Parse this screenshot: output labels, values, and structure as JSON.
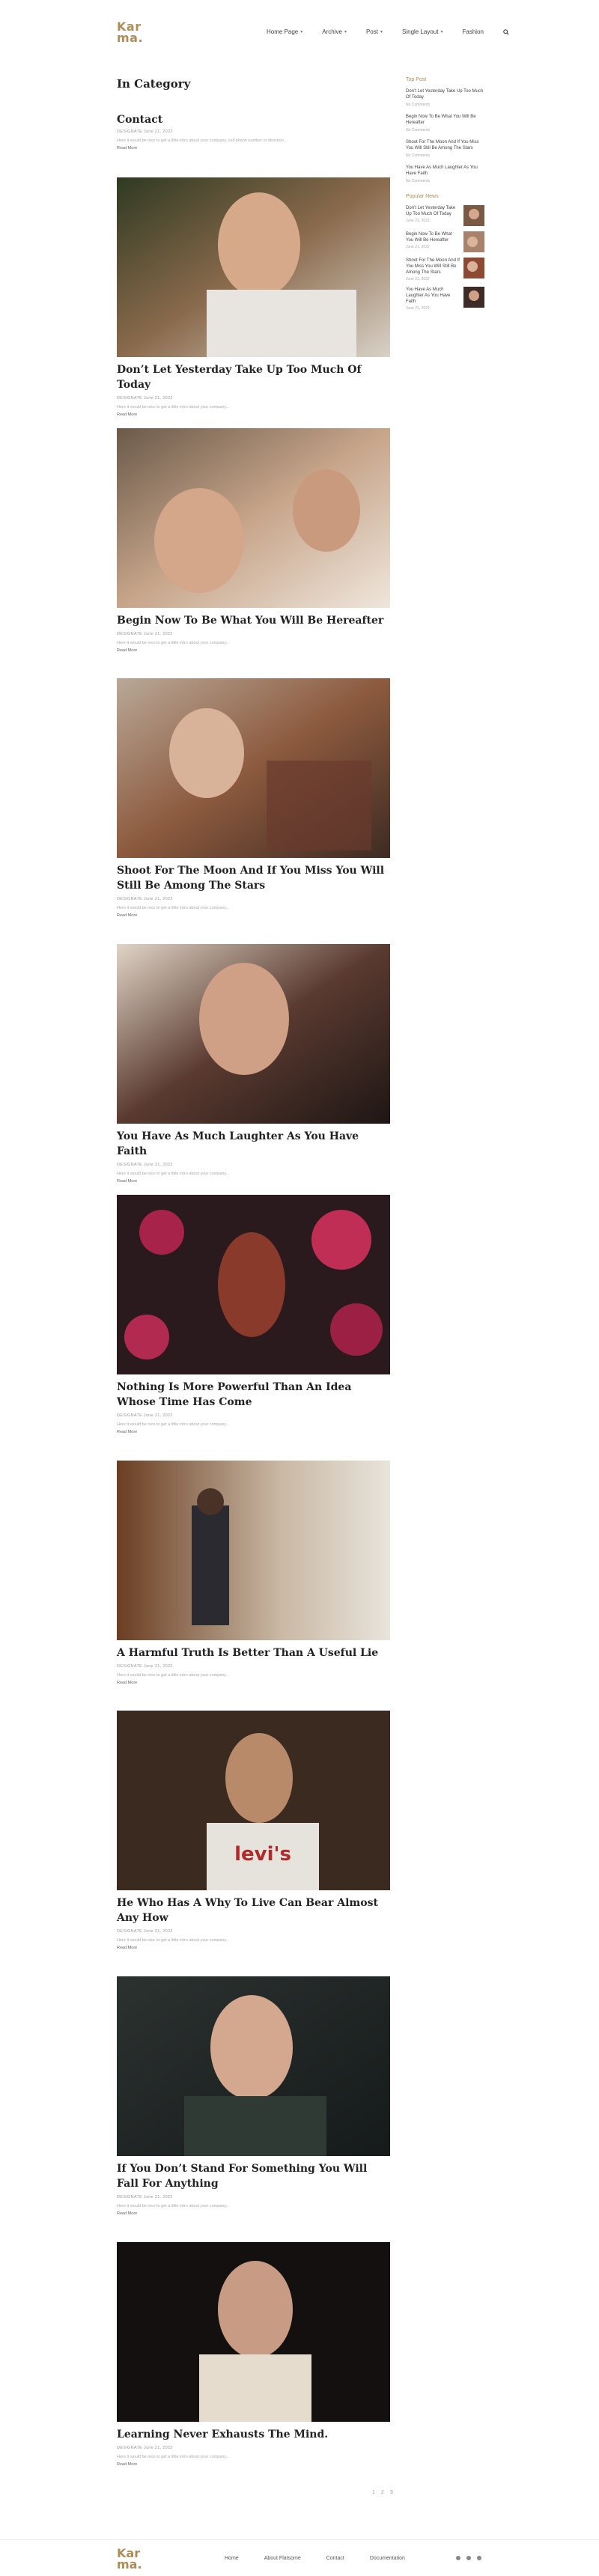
{
  "header": {
    "logo_line1": "Kar",
    "logo_line2": "ma.",
    "nav": [
      {
        "label": "Home Page",
        "dropdown": true
      },
      {
        "label": "Archive",
        "dropdown": true
      },
      {
        "label": "Post",
        "dropdown": true
      },
      {
        "label": "Single Layout",
        "dropdown": true
      },
      {
        "label": "Fashion",
        "dropdown": false
      }
    ],
    "search_icon": "search-icon"
  },
  "main": {
    "page_title": "In Category",
    "contact": {
      "title": "Contact",
      "meta": "DESIGNATE  June 21, 2022",
      "excerpt": "Here it would be nice to get a little intro about your company, cell phone number or direction...",
      "read_more": "Read More"
    },
    "posts": [
      {
        "title": "Don’t Let Yesterday Take Up Too Much Of Today",
        "meta": "DESIGNATE  June 21, 2022",
        "excerpt": "Here it would be nice to get a little intro about your company...",
        "read_more": "Read More"
      },
      {
        "title": "Begin Now To Be What You Will Be Hereafter",
        "meta": "DESIGNATE  June 21, 2022",
        "excerpt": "Here it would be nice to get a little intro about your company...",
        "read_more": "Read More"
      },
      {
        "title": "Shoot For The Moon And If You Miss You Will Still Be Among The Stars",
        "meta": "DESIGNATE  June 21, 2022",
        "excerpt": "Here it would be nice to get a little intro about your company...",
        "read_more": "Read More"
      },
      {
        "title": "You Have As Much Laughter As You Have Faith",
        "meta": "DESIGNATE  June 21, 2022",
        "excerpt": "Here it would be nice to get a little intro about your company...",
        "read_more": "Read More"
      },
      {
        "title": "Nothing Is More Powerful Than An Idea Whose Time Has Come",
        "meta": "DESIGNATE  June 21, 2022",
        "excerpt": "Here it would be nice to get a little intro about your company...",
        "read_more": "Read More"
      },
      {
        "title": "A Harmful Truth Is Better Than A Useful Lie",
        "meta": "DESIGNATE  June 21, 2022",
        "excerpt": "Here it would be nice to get a little intro about your company...",
        "read_more": "Read More"
      },
      {
        "title": "He Who Has A Why To Live Can Bear Almost Any How",
        "meta": "DESIGNATE  June 21, 2022",
        "excerpt": "Here it would be nice to get a little intro about your company...",
        "read_more": "Read More"
      },
      {
        "title": "If You Don’t Stand For Something You Will Fall For Anything",
        "meta": "DESIGNATE  June 21, 2022",
        "excerpt": "Here it would be nice to get a little intro about your company...",
        "read_more": "Read More"
      },
      {
        "title": "Learning Never Exhausts The Mind.",
        "meta": "DESIGNATE  June 21, 2022",
        "excerpt": "Here it would be nice to get a little intro about your company...",
        "read_more": "Read More"
      }
    ],
    "pagination": [
      "1",
      "2",
      "3"
    ]
  },
  "sidebar": {
    "top_post_heading": "Top Post",
    "top_posts": [
      {
        "title": "Don’t Let Yesterday Take Up Too Much Of Today",
        "sub": "No Comments"
      },
      {
        "title": "Begin Now To Be What You Will Be Hereafter",
        "sub": "No Comments"
      },
      {
        "title": "Shoot For The Moon And If You Miss You Will Still Be Among The Stars",
        "sub": "No Comments"
      },
      {
        "title": "You Have As Much Laughter As You Have Faith",
        "sub": "No Comments"
      }
    ],
    "popular_heading": "Popular News",
    "popular": [
      {
        "title": "Don’t Let Yesterday Take Up Too Much Of Today",
        "date": "June 21, 2022"
      },
      {
        "title": "Begin Now To Be What You Will Be Hereafter",
        "date": "June 21, 2022"
      },
      {
        "title": "Shoot For The Moon And If You Miss You Will Still Be Among The Stars",
        "date": "June 21, 2022"
      },
      {
        "title": "You Have As Much Laughter As You Have Faith",
        "date": "June 21, 2022"
      }
    ]
  },
  "footer": {
    "logo_line1": "Kar",
    "logo_line2": "ma.",
    "links": [
      "Home",
      "About Flatsome",
      "Contact",
      "Documentation"
    ],
    "social_icons": [
      "facebook-icon",
      "instagram-icon",
      "twitter-icon"
    ]
  },
  "colors": {
    "accent": "#b08d57"
  }
}
